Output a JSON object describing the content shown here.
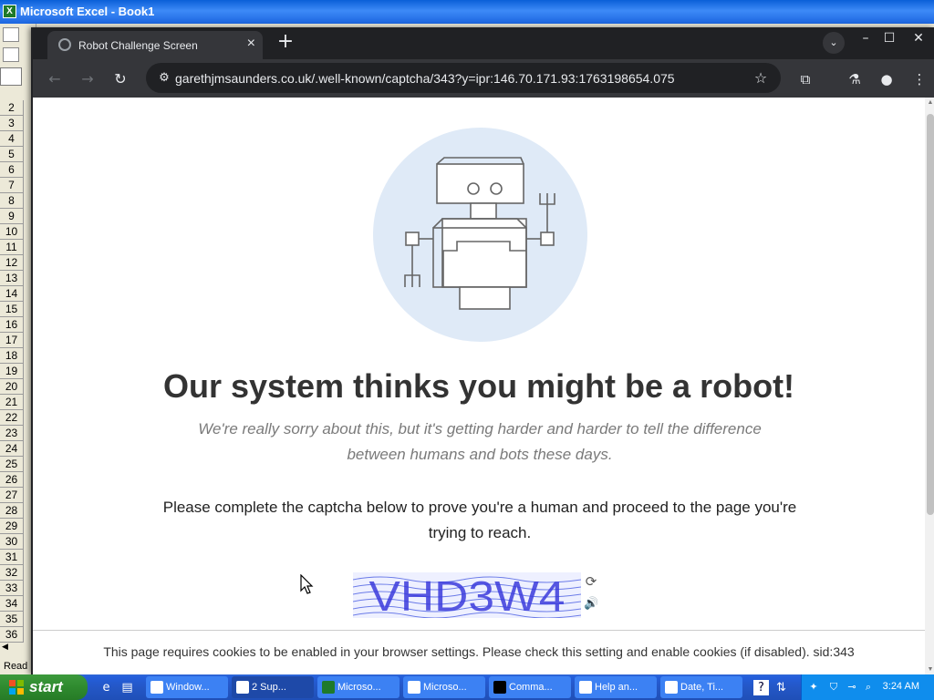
{
  "excel": {
    "title": "Microsoft Excel - Book1",
    "row_numbers": [
      "2",
      "3",
      "4",
      "5",
      "6",
      "7",
      "8",
      "9",
      "10",
      "11",
      "12",
      "13",
      "14",
      "15",
      "16",
      "17",
      "18",
      "19",
      "20",
      "21",
      "22",
      "23",
      "24",
      "25",
      "26",
      "27",
      "28",
      "29",
      "30",
      "31",
      "32",
      "33",
      "34",
      "35",
      "36"
    ],
    "status": "Read"
  },
  "browser": {
    "tab_title": "Robot Challenge Screen",
    "url": "garethjmsaunders.co.uk/.well-known/captcha/343?y=ipr:146.70.171.93:1763198654.075",
    "icons": {
      "back": "arrow-left",
      "forward": "arrow-right",
      "reload": "reload",
      "site_info": "tune",
      "bookmark": "star",
      "extensions": "puzzle",
      "labs": "flask",
      "profile": "person",
      "menu": "kebab"
    }
  },
  "page": {
    "headline": "Our system thinks you might be a robot!",
    "apology": "We're really sorry about this, but it's getting harder and harder to tell the difference between humans and bots these days.",
    "instruction": "Please complete the captcha below to prove you're a human and proceed to the page you're trying to reach.",
    "captcha_text": "VHD3W4",
    "cookie_notice": "This page requires cookies to be enabled in your browser settings. Please check this setting and enable cookies (if disabled). sid:343"
  },
  "taskbar": {
    "start_label": "start",
    "tasks": [
      {
        "label": "Window..."
      },
      {
        "label": "2 Sup..."
      },
      {
        "label": "Microso..."
      },
      {
        "label": "Microso..."
      },
      {
        "label": "Comma..."
      },
      {
        "label": "Help an..."
      },
      {
        "label": "Date, Ti..."
      }
    ],
    "clock": "3:24 AM"
  },
  "colors": {
    "chrome_dark": "#202124",
    "chrome_toolbar": "#35363a",
    "robot_circle": "#dfeaf7",
    "xp_taskbar": "#245edb",
    "xp_start": "#2f8a2f",
    "captcha_text": "#3b3bdc"
  }
}
